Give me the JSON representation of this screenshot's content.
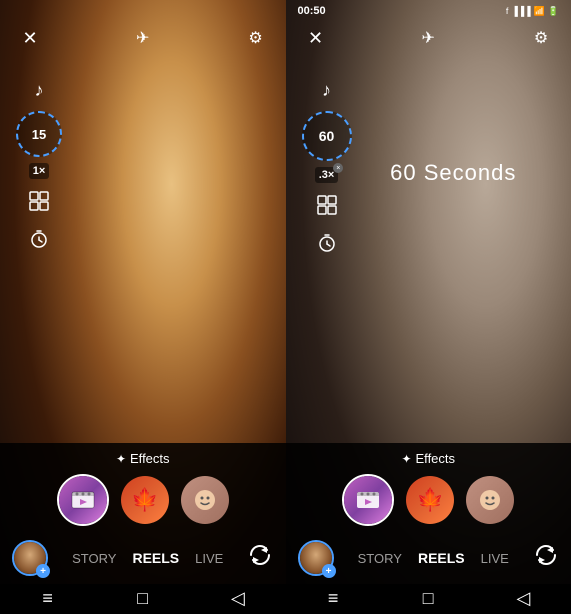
{
  "panels": [
    {
      "id": "left",
      "status_bar": {
        "visible": false
      },
      "top_controls": {
        "close": "✕",
        "flash": "✈",
        "settings": "⚙"
      },
      "side_controls": {
        "music_icon": "♪",
        "timer_value": "15",
        "speed": "1×",
        "grid": "⊞",
        "clock": "⏱"
      },
      "seconds_label": null,
      "effects": {
        "label": "Effects",
        "sparkle": "✦"
      },
      "effect_items": [
        {
          "type": "reel",
          "icon": "🎬",
          "selected": true
        },
        {
          "type": "leaf",
          "icon": "🍁",
          "selected": false
        },
        {
          "type": "face",
          "icon": "😊",
          "selected": false
        }
      ],
      "mode_tabs": {
        "tabs": [
          "STORY",
          "REELS",
          "LIVE"
        ],
        "active": "REELS"
      },
      "nav": [
        "≡",
        "□",
        "◁"
      ]
    },
    {
      "id": "right",
      "status_bar": {
        "visible": true,
        "time": "00:50",
        "icons": [
          "fb",
          "signal",
          "wifi",
          "battery"
        ]
      },
      "top_controls": {
        "close": "✕",
        "flash": "✈",
        "settings": "⚙"
      },
      "side_controls": {
        "music_icon": "♪",
        "timer_value": "60",
        "speed": ".3×",
        "grid": "⊞",
        "clock": "⏱"
      },
      "seconds_label": "60 Seconds",
      "effects": {
        "label": "Effects",
        "sparkle": "✦"
      },
      "effect_items": [
        {
          "type": "reel",
          "icon": "🎬",
          "selected": true
        },
        {
          "type": "leaf",
          "icon": "🍁",
          "selected": false
        },
        {
          "type": "face",
          "icon": "😊",
          "selected": false
        }
      ],
      "mode_tabs": {
        "tabs": [
          "STORY",
          "REELS",
          "LIVE"
        ],
        "active": "REELS"
      },
      "nav": [
        "≡",
        "□",
        "◁"
      ]
    }
  ]
}
